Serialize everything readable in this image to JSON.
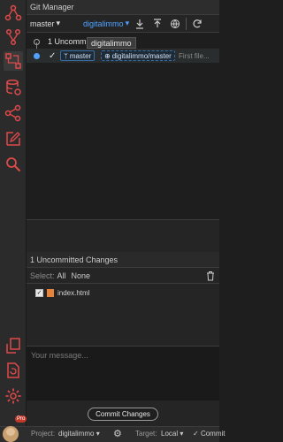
{
  "panel": {
    "title": "Git Manager"
  },
  "toolbar": {
    "branch": "master",
    "remote": "digitalimmo",
    "actions": [
      "pull-icon",
      "push-icon",
      "globe-icon",
      "refresh-icon"
    ]
  },
  "history": {
    "uncommitted_label": "1 Uncommitted",
    "tooltip": "digitalimmo",
    "commit": {
      "branch_tag": "master",
      "remote_tag": "digitalimmo/master",
      "message": "First file..."
    }
  },
  "changes": {
    "header": "1 Uncommitted Changes",
    "select_label": "Select:",
    "select_all": "All",
    "select_none": "None",
    "files": [
      {
        "name": "index.html",
        "checked": true
      }
    ]
  },
  "message": {
    "placeholder": "Your message..."
  },
  "commit_button": "Commit Changes",
  "statusbar": {
    "project_label": "Project:",
    "project": "digitalimmo",
    "target_label": "Target:",
    "target": "Local",
    "commit_label": "Commit",
    "badge": "Pro"
  },
  "colors": {
    "accent": "#4fa3ff",
    "activity_icon": "#e04a4a",
    "background": "#1e1e1e"
  }
}
